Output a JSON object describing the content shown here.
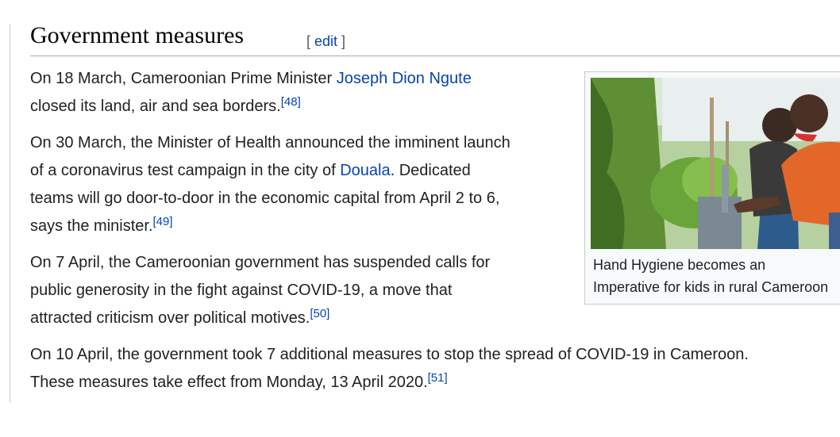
{
  "section": {
    "title": "Government measures",
    "edit_open": "[ ",
    "edit_label": "edit",
    "edit_close": " ]"
  },
  "paragraphs": [
    {
      "line1_pre": "On 18 March, Cameroonian Prime Minister ",
      "line1_link": "Joseph Dion Ngute",
      "line2_text": "closed its land, air and sea borders.",
      "ref": "[48]"
    },
    {
      "line1": "On 30 March, the Minister of Health announced the imminent launch",
      "line2_pre": "of a coronavirus test campaign in the city of ",
      "line2_link": "Douala",
      "line2_post": ". Dedicated",
      "line3": "teams will go door-to-door in the economic capital from April 2 to 6,",
      "line4_text": "says the minister.",
      "ref": "[49]"
    },
    {
      "line1": "On 7 April, the Cameroonian government has suspended calls for",
      "line2": "public generosity in the fight against COVID-19, a move that",
      "line3_text": "attracted criticism over political motives.",
      "ref": "[50]"
    },
    {
      "line1": "On 10 April, the government took 7 additional measures to stop the spread of COVID-19 in Cameroon.",
      "line2_text": "These measures take effect from Monday, 13 April 2020.",
      "ref": "[51]"
    }
  ],
  "thumbnail": {
    "caption_line1": "Hand Hygiene becomes an",
    "caption_line2": "Imperative for kids in rural Cameroon"
  },
  "colors": {
    "link": "#0645ad",
    "text": "#202122",
    "border": "#a2a9b1"
  }
}
